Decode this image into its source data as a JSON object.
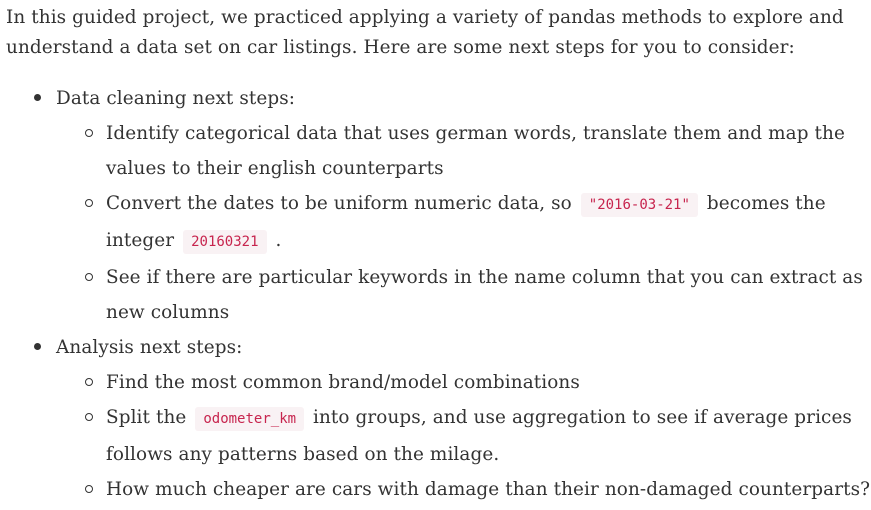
{
  "intro": "In this guided project, we practiced applying a variety of pandas methods to explore and understand a data set on car listings. Here are some next steps for you to consider:",
  "sections": [
    {
      "label": "Data cleaning next steps:",
      "items": [
        {
          "text": "Identify categorical data that uses german words, translate them and map the values to their english counterparts"
        },
        {
          "pre": "Convert the dates to be uniform numeric data, so ",
          "code1": "\"2016-03-21\"",
          "mid": " becomes the integer ",
          "code2": "20160321",
          "post": " ."
        },
        {
          "text": "See if there are particular keywords in the name column that you can extract as new columns"
        }
      ]
    },
    {
      "label": "Analysis next steps:",
      "items": [
        {
          "text": "Find the most common brand/model combinations"
        },
        {
          "pre": "Split the ",
          "code1": "odometer_km",
          "post": " into groups, and use aggregation to see if average prices follows any patterns based on the milage."
        },
        {
          "text": "How much cheaper are cars with damage than their non-damaged counterparts?"
        }
      ]
    }
  ]
}
